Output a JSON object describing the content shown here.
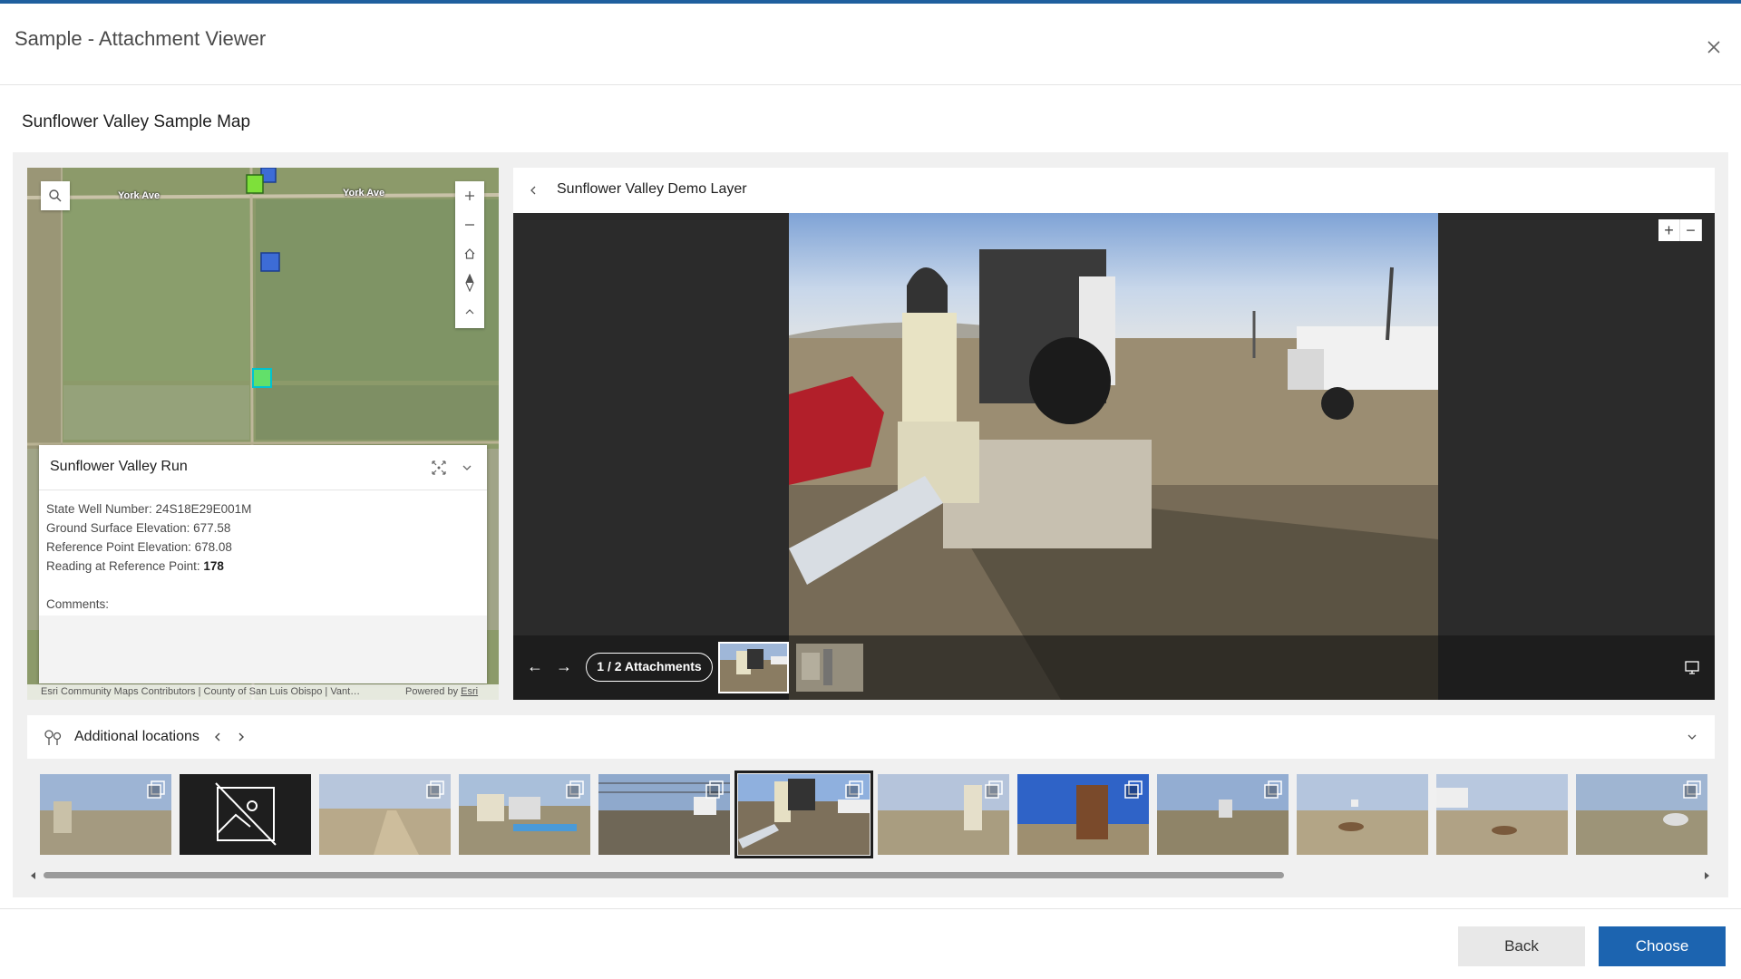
{
  "dialog": {
    "title": "Sample - Attachment Viewer"
  },
  "subtitle": "Sunflower Valley Sample Map",
  "map": {
    "road_labels": [
      "York Ave",
      "York Ave"
    ],
    "popup": {
      "title": "Sunflower Valley Run",
      "fields": [
        {
          "label": "State Well Number: ",
          "value": "24S18E29E001M"
        },
        {
          "label": "Ground Surface Elevation: ",
          "value": "677.58"
        },
        {
          "label": "Reference Point Elevation: ",
          "value": "678.08"
        },
        {
          "label": "Reading at Reference Point: ",
          "value": "178"
        }
      ],
      "comments_label": "Comments:"
    },
    "attribution": "Esri Community Maps Contributors | County of San Luis Obispo | Vant…",
    "powered_by": "Powered by ",
    "powered_by_link": "Esri"
  },
  "viewer": {
    "layer_title": "Sunflower Valley Demo Layer",
    "counter": "1 / 2 Attachments",
    "zoom_in": "+",
    "zoom_out": "−",
    "prev": "←",
    "next": "→"
  },
  "additional": {
    "label": "Additional locations",
    "selected_index": 5
  },
  "footer": {
    "back_label": "Back",
    "choose_label": "Choose"
  },
  "colors": {
    "accent": "#1c64b0",
    "top_bar": "#1f5f9e"
  }
}
